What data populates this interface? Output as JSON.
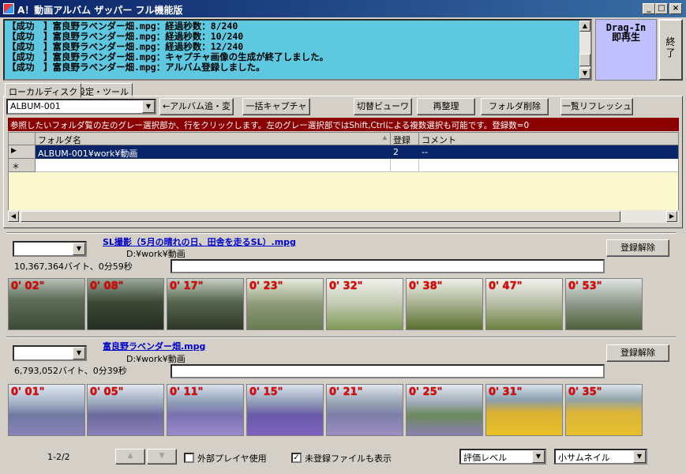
{
  "window": {
    "title": "A！動画アルバム ザッパー フル機能版",
    "min_btn": "_",
    "max_btn": "□",
    "close_btn": "×"
  },
  "log_lines": [
    "【成功　】富良野ラベンダー畑.mpg：経過秒数：8/240",
    "【成功　】富良野ラベンダー畑.mpg：経過秒数：10/240",
    "【成功　】富良野ラベンダー畑.mpg：経過秒数：12/240",
    "【成功　】富良野ラベンダー畑.mpg：キャプチャ画像の生成が終了しました。",
    "【成功　】富良野ラベンダー畑.mpg：アルバム登録しました。"
  ],
  "drag_zone": {
    "line1": "Drag-In",
    "line2": "即再生"
  },
  "exit_button": "終了",
  "tabs": [
    "ローカルディスク",
    "設定・ツール"
  ],
  "album_select": "ALBUM-001",
  "buttons": {
    "album_add": "←アルバム追・変",
    "batch_capture": "一括キャプチャ",
    "switch_view": "切替ビューワ",
    "reorganize": "再整理",
    "folder_delete": "フォルダ削除",
    "list_refresh": "一覧リフレッシュ"
  },
  "info_bar": "参照したいフォルダ覧の左のグレー選択部か、行をクリックします。左のグレー選択部ではShift,Ctrlによる複数選択も可能です。登録数=0",
  "grid": {
    "headers": [
      "フォルダ名",
      "登録",
      "コメント"
    ],
    "sort_indicator": "▲",
    "rows": [
      {
        "marker": "▶",
        "folder": "ALBUM-001¥work¥動画",
        "count": "2",
        "comment": "--"
      }
    ],
    "new_row_marker": "＊"
  },
  "videos": [
    {
      "title": "SL撮影（5月の晴れの日、田舎を走るSL）.mpg",
      "path": "D:¥work¥動画",
      "size": "10,367,364バイト、0分59秒",
      "unregister": "登録解除",
      "times": [
        "0' 02\"",
        "0' 08\"",
        "0' 17\"",
        "0' 23\"",
        "0' 32\"",
        "0' 38\"",
        "0' 47\"",
        "0' 53\""
      ]
    },
    {
      "title": "富良野ラベンダー畑.mpg",
      "path": "D:¥work¥動画",
      "size": "6,793,052バイト、0分39秒",
      "unregister": "登録解除",
      "times": [
        "0' 01\"",
        "0' 05\"",
        "0' 11\"",
        "0' 15\"",
        "0' 21\"",
        "0' 25\"",
        "0' 31\"",
        "0' 35\""
      ]
    }
  ],
  "footer": {
    "page": "1-2/2",
    "prev": "▲",
    "next": "▼",
    "external_player": "外部プレイヤ使用",
    "show_unregistered": "未登録ファイルも表示",
    "rating_select": "評価レベル",
    "thumb_select": "小サムネイル"
  },
  "colors": {
    "log_bg": "#5ec8e0",
    "drag_bg": "#c0c0ff",
    "info_bg": "#8b0000",
    "grid_sel": "#0a246a",
    "timestamp": "#e00000"
  }
}
